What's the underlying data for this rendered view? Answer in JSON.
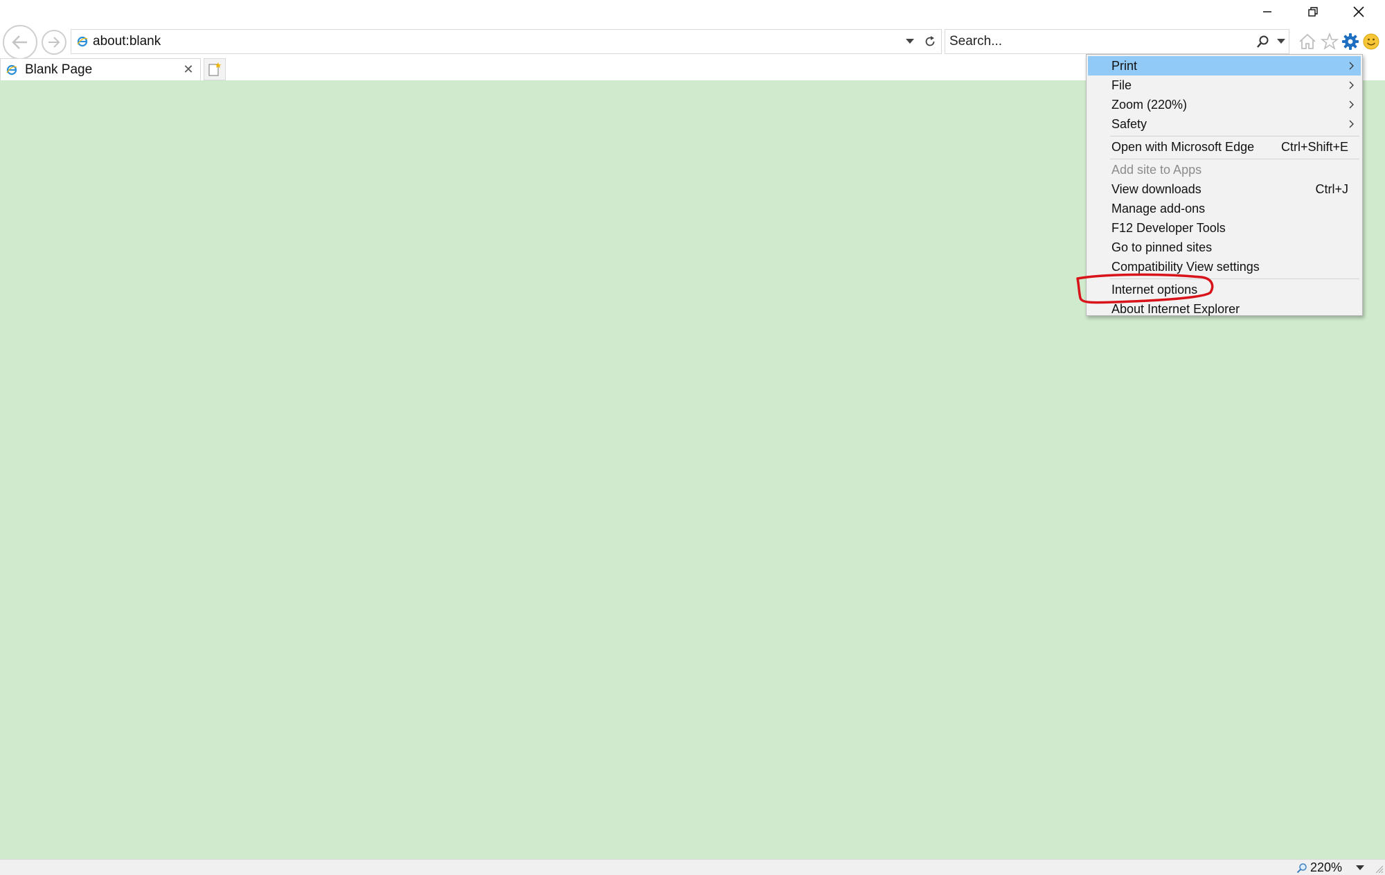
{
  "browser": {
    "address": "about:blank",
    "search_placeholder": "Search...",
    "tab_title": "Blank Page"
  },
  "window_controls": {
    "minimize": "—",
    "restore": "❐",
    "close": "✕"
  },
  "tab": {
    "close_glyph": "✕"
  },
  "tools_menu": {
    "items": [
      {
        "label": "Print",
        "shortcut": "",
        "submenu": true,
        "highlighted": true,
        "disabled": false
      },
      {
        "label": "File",
        "shortcut": "",
        "submenu": true,
        "highlighted": false,
        "disabled": false
      },
      {
        "label": "Zoom (220%)",
        "shortcut": "",
        "submenu": true,
        "highlighted": false,
        "disabled": false
      },
      {
        "label": "Safety",
        "shortcut": "",
        "submenu": true,
        "highlighted": false,
        "disabled": false
      },
      {
        "label": "Open with Microsoft Edge",
        "shortcut": "Ctrl+Shift+E",
        "submenu": false,
        "highlighted": false,
        "disabled": false
      },
      {
        "label": "Add site to Apps",
        "shortcut": "",
        "submenu": false,
        "highlighted": false,
        "disabled": true
      },
      {
        "label": "View downloads",
        "shortcut": "Ctrl+J",
        "submenu": false,
        "highlighted": false,
        "disabled": false
      },
      {
        "label": "Manage add-ons",
        "shortcut": "",
        "submenu": false,
        "highlighted": false,
        "disabled": false
      },
      {
        "label": "F12 Developer Tools",
        "shortcut": "",
        "submenu": false,
        "highlighted": false,
        "disabled": false
      },
      {
        "label": "Go to pinned sites",
        "shortcut": "",
        "submenu": false,
        "highlighted": false,
        "disabled": false
      },
      {
        "label": "Compatibility View settings",
        "shortcut": "",
        "submenu": false,
        "highlighted": false,
        "disabled": false
      },
      {
        "label": "Internet options",
        "shortcut": "",
        "submenu": false,
        "highlighted": false,
        "disabled": false
      },
      {
        "label": "About Internet Explorer",
        "shortcut": "",
        "submenu": false,
        "highlighted": false,
        "disabled": false
      }
    ]
  },
  "statusbar": {
    "zoom": "220%"
  },
  "icons": {
    "back": "back-arrow-icon",
    "forward": "forward-arrow-icon",
    "refresh": "refresh-icon",
    "search": "search-icon",
    "home": "home-icon",
    "favorites": "star-icon",
    "tools": "gear-icon",
    "feedback": "smiley-icon"
  },
  "colors": {
    "content_background": "#d0eacd",
    "menu_highlight": "#91c9f7",
    "annotation_stroke": "#d8141a",
    "gear_blue": "#1f6fc1"
  }
}
